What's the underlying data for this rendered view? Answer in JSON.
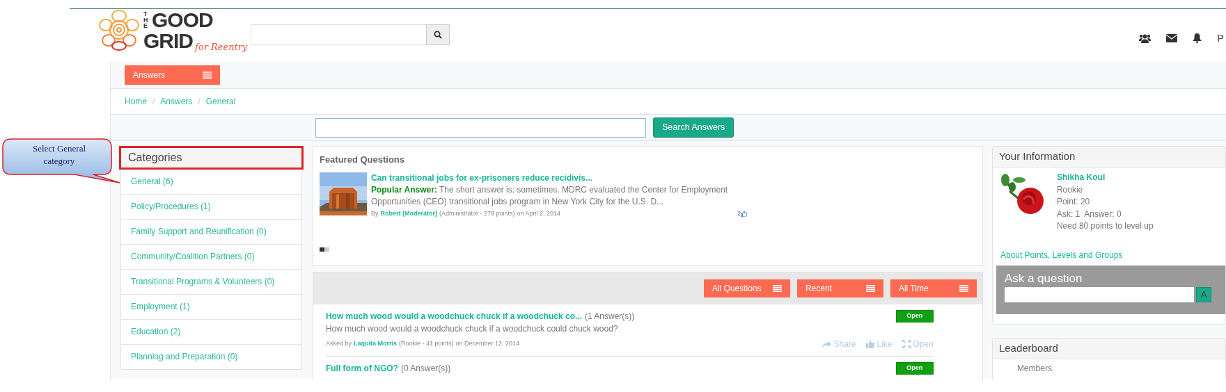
{
  "annotation": {
    "text": "Select General category"
  },
  "header": {
    "logo": {
      "the": "THE",
      "good": "GOOD",
      "grid": "GRID",
      "tagline": "for Reentry"
    },
    "user_initial": "P"
  },
  "toolbar": {
    "menu_button": "Answers"
  },
  "breadcrumb": {
    "separator": "/",
    "items": [
      "Home",
      "Answers",
      "General"
    ]
  },
  "answer_search": {
    "button": "Search Answers"
  },
  "categories": {
    "title": "Categories",
    "items": [
      "General (6)",
      "Policy/Procedures (1)",
      "Family Support and Reunification (0)",
      "Community/Coalition Partners (0)",
      "Transitional Programs & Volunteers (0)",
      "Employment (1)",
      "Education (2)",
      "Planning and Preparation (0)"
    ]
  },
  "featured": {
    "title": "Featured Questions",
    "items": [
      {
        "question": "Can transitional jobs for ex-prisoners reduce recidivis...",
        "answer_label": "Popular Answer:",
        "answer": "The short answer is: sometimes. MDRC evaluated the Center for Employment Opportunities (CEO) transitional jobs program in New York City for the U.S. D...",
        "by": "By",
        "author": "Robert (Moderator)",
        "author_meta": "(Administrator - 279 points)",
        "date": "on April 2, 2014",
        "likes": "2"
      }
    ],
    "pages": [
      {
        "selected": true
      },
      {
        "selected": false
      }
    ]
  },
  "questions": {
    "filters": [
      "All Questions",
      "Recent",
      "All Time"
    ],
    "items": [
      {
        "title": "How much wood would a woodchuck chuck if a woodchuck co...",
        "answers": "(1 Answer(s))",
        "status": "Open",
        "body": "How much wood would a woodchuck chuck if a woodchuck could chuck wood?",
        "asked_by": "Asked by",
        "author": "Laquita Morris",
        "author_meta": "(Rookie - 41 points)",
        "date": "on December 12, 2014",
        "actions": [
          "Share",
          "Like",
          "Open"
        ]
      },
      {
        "title": "Full form of NGO?",
        "answers": "(0 Answer(s))",
        "status": "Open"
      }
    ]
  },
  "your_info": {
    "title": "Your Information",
    "name": "Shikha Koul",
    "rank": "Rookie",
    "points": "Point: 20",
    "ask": "Ask: 1",
    "answer": "Answer: 0",
    "need": "Need 80 points to level up",
    "link": "About Points, Levels and Groups"
  },
  "ask_box": {
    "title": "Ask a question",
    "button": "A"
  },
  "leaderboard": {
    "title": "Leaderboard",
    "column": "Members"
  }
}
